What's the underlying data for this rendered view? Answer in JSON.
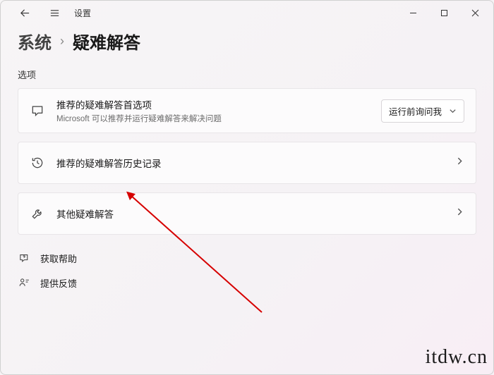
{
  "titlebar": {
    "app_title": "设置"
  },
  "breadcrumb": {
    "parent": "系统",
    "separator": "›",
    "current": "疑难解答"
  },
  "section_label": "选项",
  "cards": {
    "recommended_pref": {
      "title": "推荐的疑难解答首选项",
      "desc": "Microsoft 可以推荐并运行疑难解答来解决问题",
      "dropdown_value": "运行前询问我"
    },
    "history": {
      "title": "推荐的疑难解答历史记录"
    },
    "other": {
      "title": "其他疑难解答"
    }
  },
  "links": {
    "help": "获取帮助",
    "feedback": "提供反馈"
  },
  "watermark": "itdw.cn"
}
